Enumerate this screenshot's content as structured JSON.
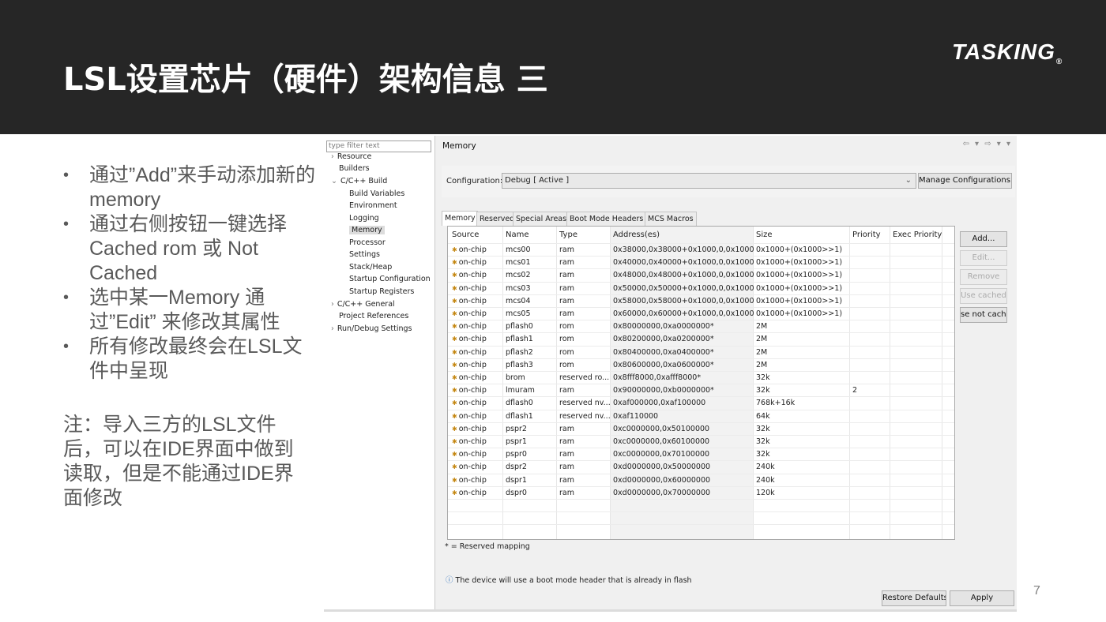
{
  "slide": {
    "title": "LSL设置芯片（硬件）架构信息 三",
    "logo": "TASKING",
    "logo_mark": "®",
    "bullets": [
      "通过”Add”来手动添加新的memory",
      "通过右侧按钮一键选择Cached rom 或 Not Cached",
      "选中某一Memory 通过”Edit” 来修改其属性",
      "所有修改最终会在LSL文件中呈现"
    ],
    "note": "注：导入三方的LSL文件后，可以在IDE界面中做到读取，但是不能通过IDE界面修改",
    "page_number": "7"
  },
  "tree": {
    "filter_placeholder": "type filter text",
    "items": [
      {
        "label": "Resource",
        "arrow": "›"
      },
      {
        "label": "Builders",
        "arrow": ""
      },
      {
        "label": "C/C++ Build",
        "arrow": "⌄"
      },
      {
        "label": "Build Variables",
        "arrow": ""
      },
      {
        "label": "Environment",
        "arrow": ""
      },
      {
        "label": "Logging",
        "arrow": ""
      },
      {
        "label": "Memory",
        "arrow": ""
      },
      {
        "label": "Processor",
        "arrow": ""
      },
      {
        "label": "Settings",
        "arrow": ""
      },
      {
        "label": "Stack/Heap",
        "arrow": ""
      },
      {
        "label": "Startup Configuration",
        "arrow": ""
      },
      {
        "label": "Startup Registers",
        "arrow": ""
      },
      {
        "label": "C/C++ General",
        "arrow": "›"
      },
      {
        "label": "Project References",
        "arrow": ""
      },
      {
        "label": "Run/Debug Settings",
        "arrow": "›"
      }
    ]
  },
  "panel": {
    "title": "Memory",
    "nav": "⇦ ▾ ⇨ ▾ ▾",
    "config_label": "Configuration:",
    "config_value": "Debug  [ Active ]",
    "config_dropdown": "⌄",
    "manage_button": "Manage Configurations...",
    "tabs": [
      "Memory",
      "Reserved",
      "Special Areas",
      "Boot Mode Headers",
      "MCS Macros"
    ],
    "sort_indicator": "^",
    "columns": [
      "Source",
      "Name",
      "Type",
      "Address(es)",
      "Size",
      "Priority",
      "Exec Priority"
    ],
    "rows": [
      [
        "on-chip",
        "mcs00",
        "ram",
        "0x38000,0x38000+0x1000,0,0x1000",
        "0x1000+(0x1000>>1)",
        ""
      ],
      [
        "on-chip",
        "mcs01",
        "ram",
        "0x40000,0x40000+0x1000,0,0x1000",
        "0x1000+(0x1000>>1)",
        ""
      ],
      [
        "on-chip",
        "mcs02",
        "ram",
        "0x48000,0x48000+0x1000,0,0x1000",
        "0x1000+(0x1000>>1)",
        ""
      ],
      [
        "on-chip",
        "mcs03",
        "ram",
        "0x50000,0x50000+0x1000,0,0x1000",
        "0x1000+(0x1000>>1)",
        ""
      ],
      [
        "on-chip",
        "mcs04",
        "ram",
        "0x58000,0x58000+0x1000,0,0x1000",
        "0x1000+(0x1000>>1)",
        ""
      ],
      [
        "on-chip",
        "mcs05",
        "ram",
        "0x60000,0x60000+0x1000,0,0x1000",
        "0x1000+(0x1000>>1)",
        ""
      ],
      [
        "on-chip",
        "pflash0",
        "rom",
        "0x80000000,0xa0000000*",
        "2M",
        ""
      ],
      [
        "on-chip",
        "pflash1",
        "rom",
        "0x80200000,0xa0200000*",
        "2M",
        ""
      ],
      [
        "on-chip",
        "pflash2",
        "rom",
        "0x80400000,0xa0400000*",
        "2M",
        ""
      ],
      [
        "on-chip",
        "pflash3",
        "rom",
        "0x80600000,0xa0600000*",
        "2M",
        ""
      ],
      [
        "on-chip",
        "brom",
        "reserved ro...",
        "0x8fff8000,0xafff8000*",
        "32k",
        ""
      ],
      [
        "on-chip",
        "lmuram",
        "ram",
        "0x90000000,0xb0000000*",
        "32k",
        "2"
      ],
      [
        "on-chip",
        "dflash0",
        "reserved nv...",
        "0xaf000000,0xaf100000",
        "768k+16k",
        ""
      ],
      [
        "on-chip",
        "dflash1",
        "reserved nv...",
        "0xaf110000",
        "64k",
        ""
      ],
      [
        "on-chip",
        "pspr2",
        "ram",
        "0xc0000000,0x50100000",
        "32k",
        ""
      ],
      [
        "on-chip",
        "pspr1",
        "ram",
        "0xc0000000,0x60100000",
        "32k",
        ""
      ],
      [
        "on-chip",
        "pspr0",
        "ram",
        "0xc0000000,0x70100000",
        "32k",
        ""
      ],
      [
        "on-chip",
        "dspr2",
        "ram",
        "0xd0000000,0x50000000",
        "240k",
        ""
      ],
      [
        "on-chip",
        "dspr1",
        "ram",
        "0xd0000000,0x60000000",
        "240k",
        ""
      ],
      [
        "on-chip",
        "dspr0",
        "ram",
        "0xd0000000,0x70000000",
        "120k",
        ""
      ]
    ],
    "side_buttons": [
      "Add...",
      "Edit...",
      "Remove",
      "Use cached",
      "se not cache"
    ],
    "footnote": "* = Reserved mapping",
    "info_icon": "ⓘ",
    "info_text": "The device will use a boot mode header that is already in flash",
    "restore_button": "Restore Defaults",
    "apply_button": "Apply"
  }
}
